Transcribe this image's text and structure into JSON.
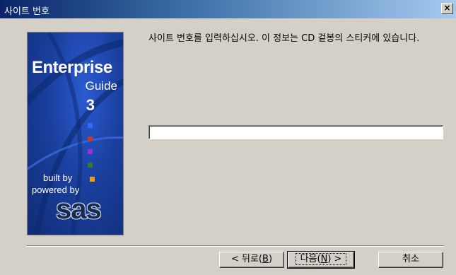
{
  "window": {
    "title": "사이트 번호",
    "close_label": "×"
  },
  "banner": {
    "product": "Enterprise",
    "subtitle": "Guide",
    "version": "3",
    "built_by": "built by",
    "powered_by": "powered by",
    "brand": "sas",
    "square_colors": [
      "#2b6bff",
      "#c0392b",
      "#9b30d9",
      "#2e7d32",
      "#f39c12"
    ]
  },
  "instruction": "사이트 번호를 입력하십시오. 이 정보는 CD 겉봉의 스티커에 있습니다.",
  "site_number": {
    "value": "",
    "placeholder": ""
  },
  "buttons": {
    "back": {
      "pre": "< 뒤로(",
      "key": "B",
      "post": ")"
    },
    "next": {
      "pre": "다음(",
      "key": "N",
      "post": ") >"
    },
    "cancel": "취소"
  }
}
